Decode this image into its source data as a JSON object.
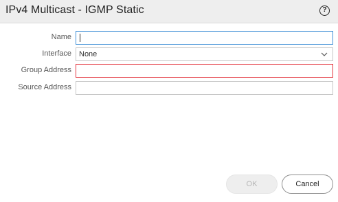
{
  "dialog": {
    "title": "IPv4 Multicast - IGMP Static",
    "help_icon": "help-circle-icon",
    "help_glyph": "?"
  },
  "form": {
    "name": {
      "label": "Name",
      "value": ""
    },
    "interface": {
      "label": "Interface",
      "value": "None",
      "icon": "chevron-down-icon"
    },
    "group_address": {
      "label": "Group Address",
      "value": ""
    },
    "source_address": {
      "label": "Source Address",
      "value": ""
    }
  },
  "buttons": {
    "ok_label": "OK",
    "cancel_label": "Cancel"
  },
  "colors": {
    "focus_border": "#3f8fd6",
    "error_border": "#e3323b",
    "header_bg": "#eeeeee"
  }
}
